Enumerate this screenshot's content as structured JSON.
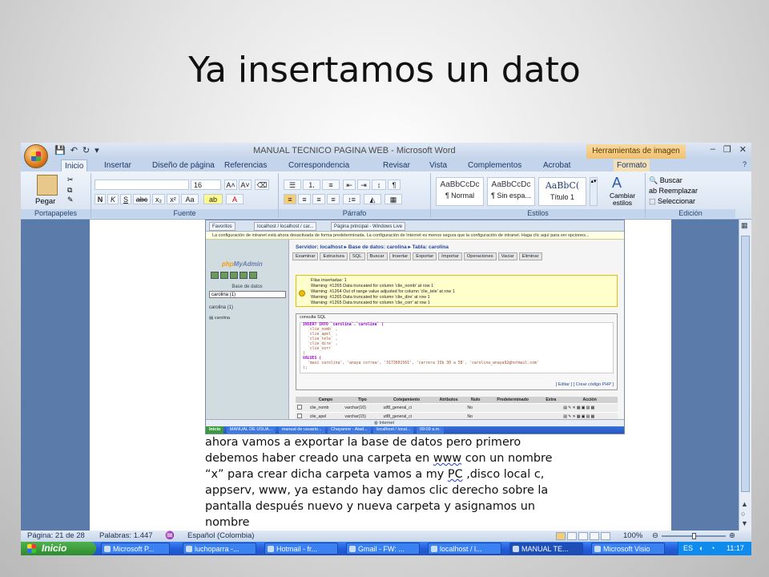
{
  "slide": {
    "title": "Ya insertamos un dato"
  },
  "word": {
    "title": "MANUAL TECNICO PAGINA WEB - Microsoft Word",
    "contextual_tab_group": "Herramientas de imagen",
    "tabs": [
      "Inicio",
      "Insertar",
      "Diseño de página",
      "Referencias",
      "Correspondencia",
      "Revisar",
      "Vista",
      "Complementos",
      "Acrobat",
      "Formato"
    ],
    "ribbon": {
      "clipboard": {
        "paste": "Pegar",
        "label": "Portapapeles"
      },
      "font": {
        "size": "16",
        "bold": "N",
        "italic": "K",
        "underline": "S",
        "label": "Fuente"
      },
      "paragraph": {
        "label": "Párrafo"
      },
      "styles": {
        "items": [
          {
            "preview": "AaBbCcDc",
            "name": "¶ Normal"
          },
          {
            "preview": "AaBbCcDc",
            "name": "¶ Sin espa..."
          },
          {
            "preview": "AaBbC(",
            "name": "Título 1"
          }
        ],
        "change": "Cambiar estilos",
        "label": "Estilos"
      },
      "editing": {
        "find": "Buscar",
        "replace": "Reemplazar",
        "select": "Seleccionar",
        "label": "Edición"
      }
    },
    "embedded": {
      "ie_tabs": [
        "Favoritos",
        "localhost / localhost / car...",
        "Página principal - Windows Live"
      ],
      "infobar": "La configuración de intranet está ahora desactivada de forma predeterminada. La configuración de Internet es menos segura que la configuración de intranet. Haga clic aquí para ver opciones...",
      "pma_logo_a": "php",
      "pma_logo_b": "MyAdmin",
      "db_label": "Base de datos",
      "db_select": "carolina (1)",
      "db_name": "carolina (1)",
      "table_name": "carolina",
      "breadcrumb": "Servidor: localhost ▸ Base de datos: carolina ▸ Tabla: carolina",
      "tabs": [
        "Examinar",
        "Estructura",
        "SQL",
        "Buscar",
        "Insertar",
        "Exportar",
        "Importar",
        "Operaciones",
        "Vaciar",
        "Eliminar"
      ],
      "warnings": [
        "Filas insertadas: 1",
        "Warning: #1265 Data truncated for column 'clie_nomb' at row 1",
        "Warning: #1264 Out of range value adjusted for column 'clie_tele' at row 1",
        "Warning: #1265 Data truncated for column 'clie_dire' at row 1",
        "Warning: #1265 Data truncated for column 'clie_corr' at row 1"
      ],
      "sql_legend": "consulta SQL",
      "sql_lines": [
        "INSERT INTO `carolina`.`carolina` (",
        "`clie_nomb` ,",
        "`clie_apel` ,",
        "`clie_tele` ,",
        "`clie_dire` ,",
        "`clie_corr`",
        ")",
        "VALUES (",
        "'maxi carolina', 'anaya correa', '3173601561', 'carrera 33b 30 a 58', 'carolina_anaya92@hotmail.com'",
        ");"
      ],
      "sql_actions": "[ Editar ] [ Crear código PHP ]",
      "table_headers": [
        "Campo",
        "Tipo",
        "Cotejamiento",
        "Atributos",
        "Nulo",
        "Predeterminado",
        "Extra",
        "Acción"
      ],
      "rows": [
        {
          "field": "clie_nomb",
          "type": "varchar(10)",
          "collation": "utf8_general_ci",
          "null": "No"
        },
        {
          "field": "clie_apel",
          "type": "varchar(15)",
          "collation": "utf8_general_ci",
          "null": "No"
        }
      ],
      "ie_status": "Internet",
      "xp_items": [
        "Inicio",
        "MANUAL DE USUA...",
        "manual de usuario...",
        "Chayanne - Atad...",
        "localhost / local...",
        "09:09 a.m."
      ]
    },
    "document_lines": [
      "ahora vamos a exportar la base de datos pero primero",
      "debemos  haber creado una carpeta en ",
      "www",
      " con un nombre",
      "“x” para crear dicha carpeta  vamos a my ",
      "PC",
      " ,disco local c,",
      "appserv, www, ya estando hay  damos clic derecho sobre la",
      "pantalla  después nuevo y nueva carpeta y asignamos un",
      "nombre"
    ],
    "status": {
      "page": "Página: 21 de 28",
      "words": "Palabras: 1.447",
      "language": "Español (Colombia)",
      "zoom": "100%"
    },
    "taskbar": {
      "start": "Inicio",
      "items": [
        "Microsoft P...",
        "luchoparra -...",
        "Hotmail - fr...",
        "Gmail - FW: ...",
        "localhost / l...",
        "MANUAL TE...",
        "Microsoft Visio"
      ],
      "lang": "ES",
      "clock": "11:17"
    }
  }
}
